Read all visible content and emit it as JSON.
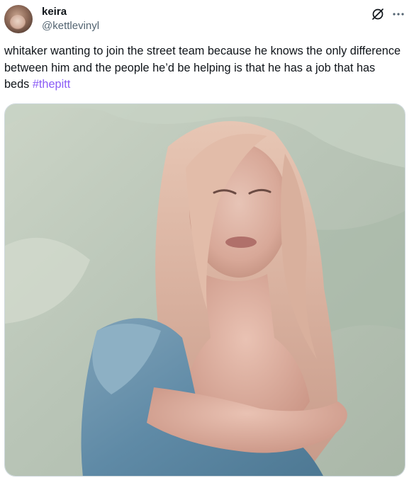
{
  "tweet": {
    "author": {
      "display_name": "keira",
      "handle": "@kettlevinyl"
    },
    "text": "whitaker wanting to join the street team because he knows the only difference between him and the people he’d be helping is that he has a job that has beds",
    "hashtag": "#thepitt",
    "actions": {
      "grok_icon": "grok-icon",
      "more_icon": "more-icon"
    },
    "media": {
      "type": "gif"
    }
  },
  "colors": {
    "text": "#0f1419",
    "secondary": "#536471",
    "hashtag": "#8b5cf6",
    "border": "#cfd9de"
  }
}
